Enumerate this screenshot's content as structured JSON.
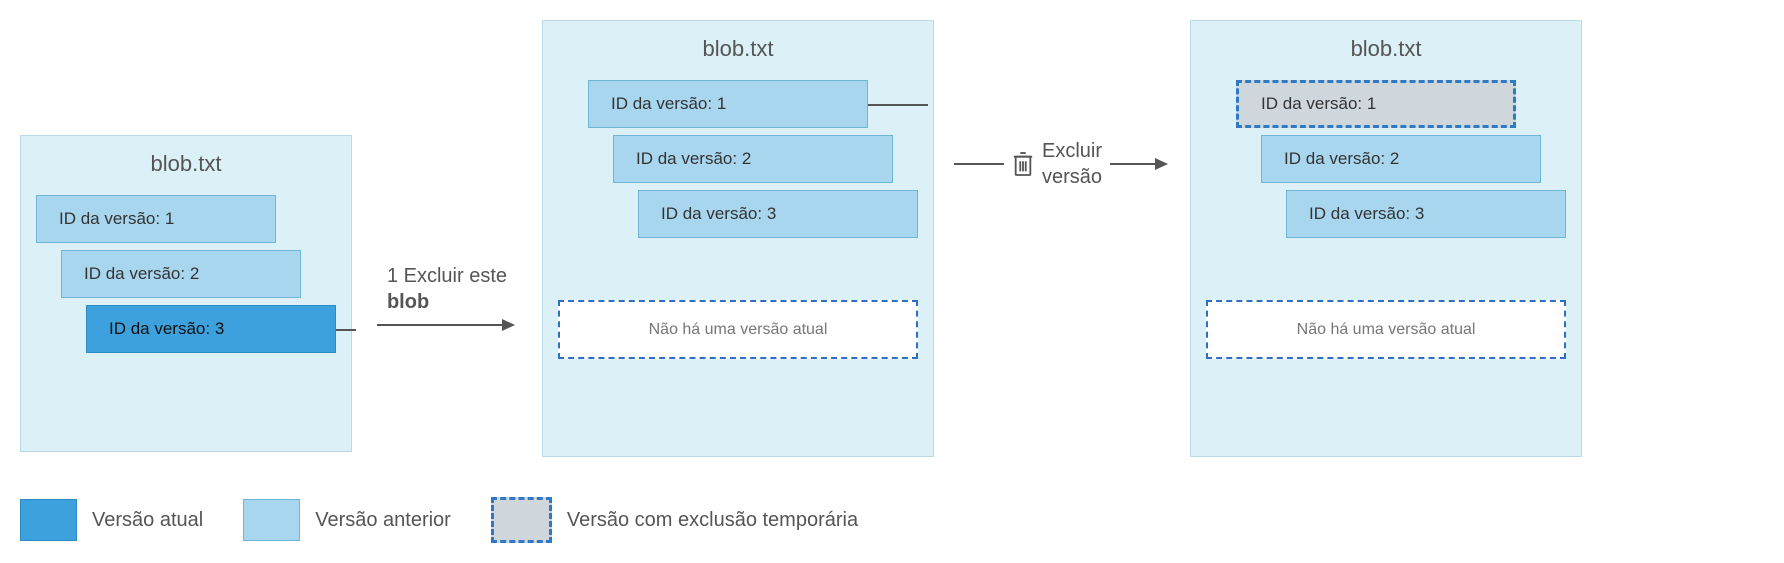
{
  "panels": {
    "p1": {
      "title": "blob.txt",
      "v1": "ID da versão: 1",
      "v2": "ID da versão: 2",
      "v3": "ID da versão: 3"
    },
    "p2": {
      "title": "blob.txt",
      "v1": "ID da versão: 1",
      "v2": "ID da versão: 2",
      "v3": "ID da versão: 3",
      "no_current": "Não há uma versão atual"
    },
    "p3": {
      "title": "blob.txt",
      "v1": "ID da versão: 1",
      "v2": "ID da versão: 2",
      "v3": "ID da versão: 3",
      "no_current": "Não há uma versão atual"
    }
  },
  "actions": {
    "a1_line1": "1 Excluir este",
    "a1_line2": "blob",
    "a2_line1": "Excluir",
    "a2_line2": "versão"
  },
  "legend": {
    "current": "Versão atual",
    "previous": "Versão anterior",
    "softdeleted": "Versão com exclusão temporária"
  },
  "colors": {
    "panel_bg": "#dcf0f7",
    "prev_bg": "#a9d6ef",
    "current_bg": "#3ca1dc",
    "softdel_bg": "#cfd6dc",
    "dash_border": "#2f78c2"
  }
}
